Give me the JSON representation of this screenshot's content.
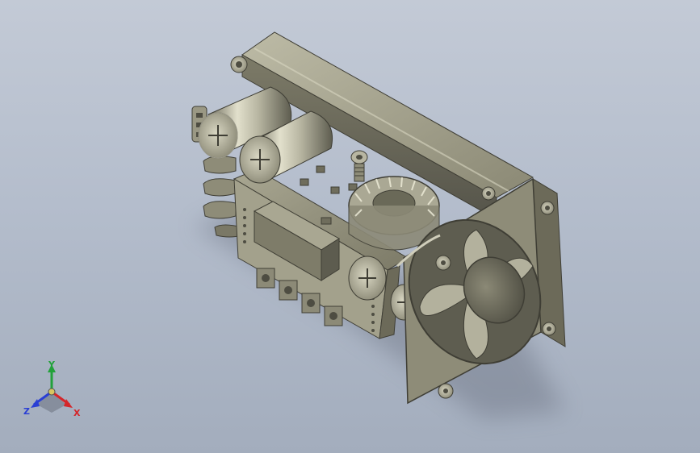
{
  "triad": {
    "x_label": "X",
    "y_label": "Y",
    "z_label": "Z",
    "x_color": "#d4262a",
    "y_color": "#22a13a",
    "z_color": "#2a3fd4"
  },
  "model": {
    "body_color": "#8e8c78",
    "highlight_color": "#c9c7b2",
    "shadow_color": "#4f4e42"
  }
}
